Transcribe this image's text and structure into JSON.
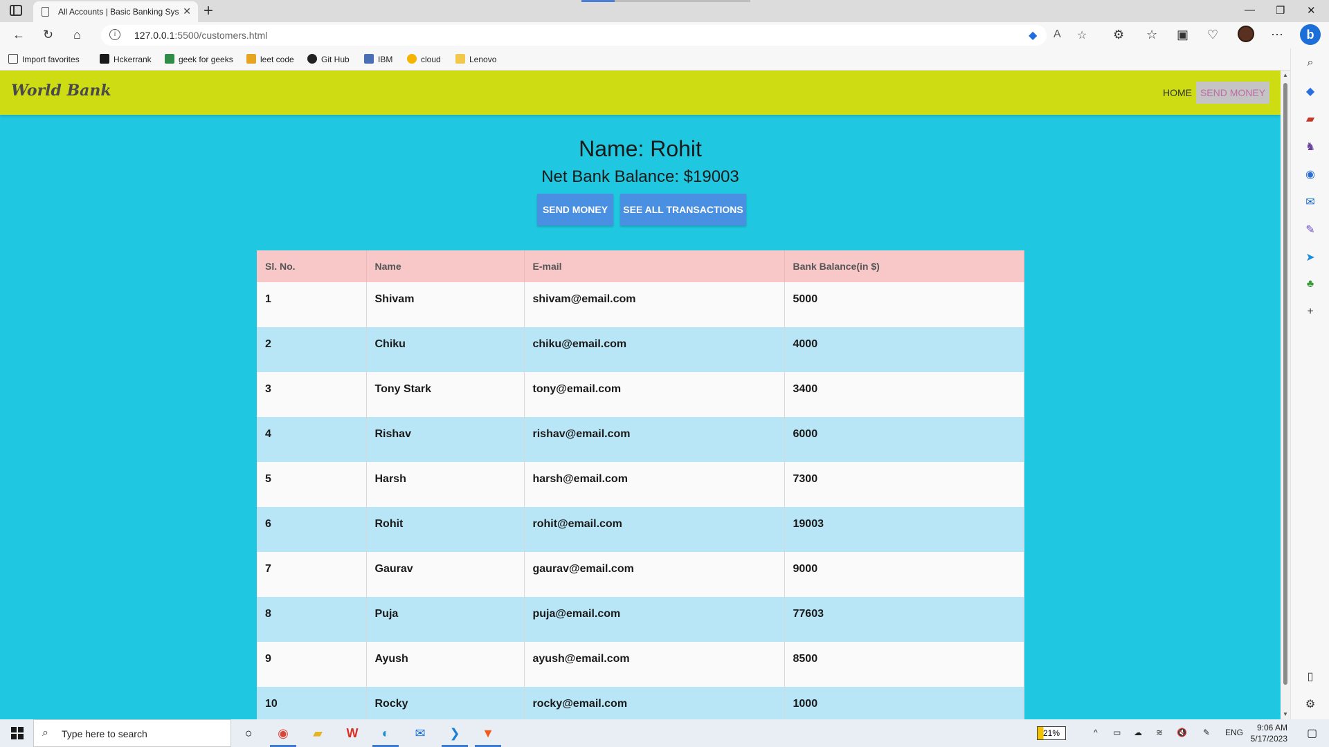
{
  "browser": {
    "tab_title": "All Accounts | Basic Banking Syst",
    "url_host": "127.0.0.1",
    "url_path": ":5500/customers.html",
    "favorites": [
      "Import favorites",
      "Hckerrank",
      "geek for geeks",
      "leet code",
      "Git Hub",
      "IBM",
      "cloud",
      "Lenovo"
    ]
  },
  "navbar": {
    "brand": "World Bank",
    "home": "HOME",
    "send_money": "SEND MONEY"
  },
  "account": {
    "name_heading": "Name: Rohit",
    "balance_heading": "Net Bank Balance: $19003",
    "send_button": "SEND MONEY",
    "transactions_button": "SEE ALL TRANSACTIONS"
  },
  "table": {
    "headers": [
      "Sl. No.",
      "Name",
      "E-mail",
      "Bank Balance(in $)"
    ],
    "rows": [
      [
        "1",
        "Shivam",
        "shivam@email.com",
        "5000"
      ],
      [
        "2",
        "Chiku",
        "chiku@email.com",
        "4000"
      ],
      [
        "3",
        "Tony Stark",
        "tony@email.com",
        "3400"
      ],
      [
        "4",
        "Rishav",
        "rishav@email.com",
        "6000"
      ],
      [
        "5",
        "Harsh",
        "harsh@email.com",
        "7300"
      ],
      [
        "6",
        "Rohit",
        "rohit@email.com",
        "19003"
      ],
      [
        "7",
        "Gaurav",
        "gaurav@email.com",
        "9000"
      ],
      [
        "8",
        "Puja",
        "puja@email.com",
        "77603"
      ],
      [
        "9",
        "Ayush",
        "ayush@email.com",
        "8500"
      ],
      [
        "10",
        "Rocky",
        "rocky@email.com",
        "1000"
      ]
    ]
  },
  "taskbar": {
    "search_placeholder": "Type here to search",
    "battery": "21%",
    "language": "ENG",
    "time": "9:06 AM",
    "date": "5/17/2023"
  }
}
